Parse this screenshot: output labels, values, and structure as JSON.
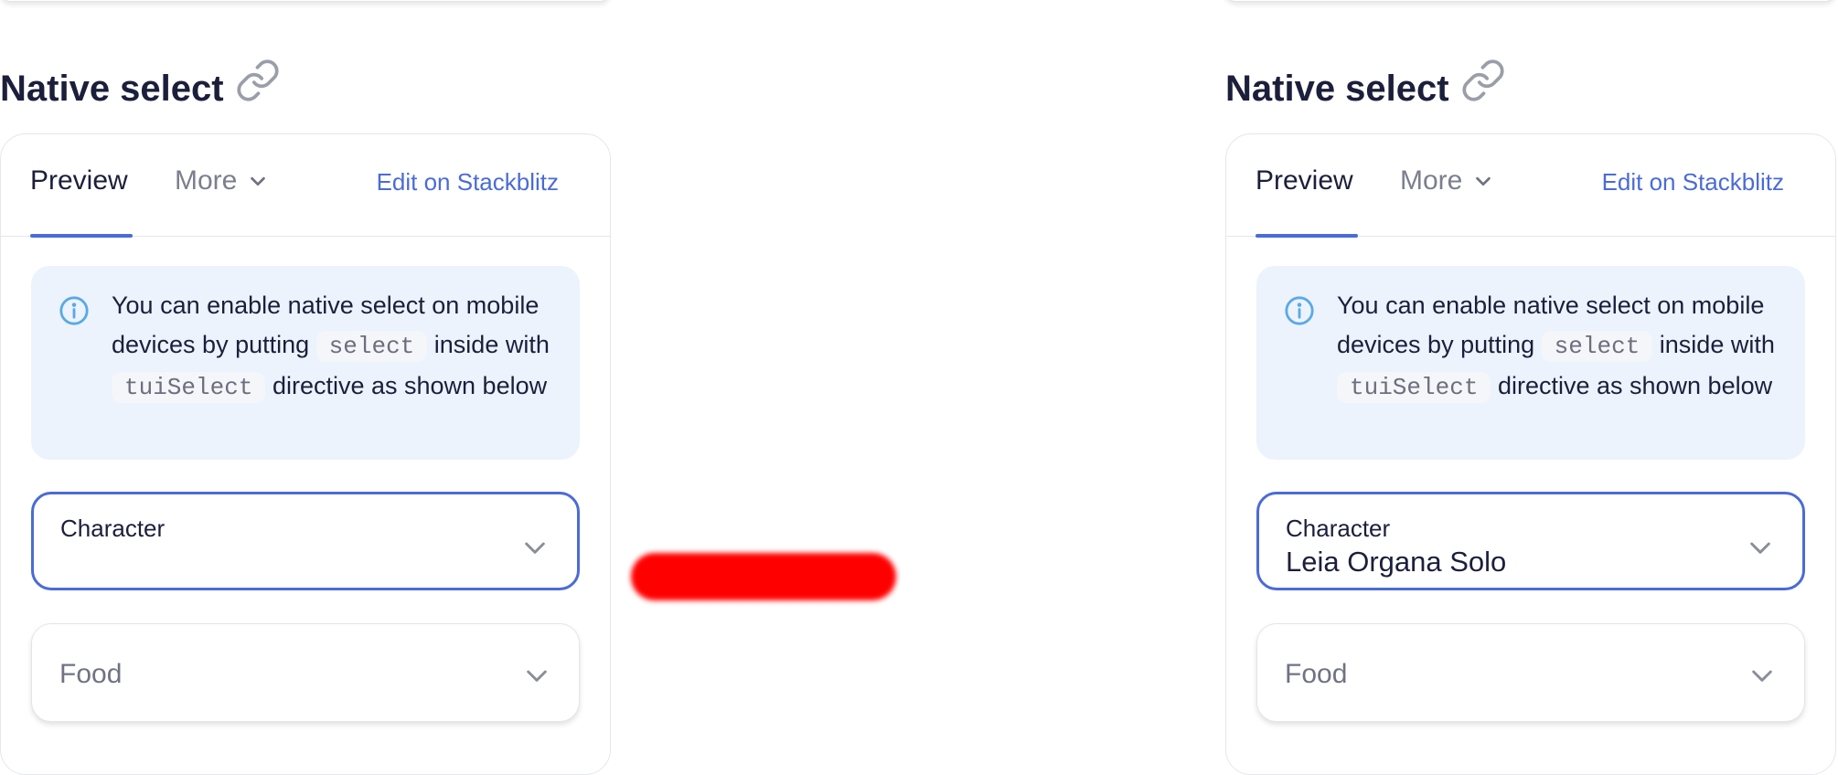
{
  "panels": [
    {
      "heading": "Native select",
      "tabs": {
        "preview": "Preview",
        "more": "More",
        "edit": "Edit on Stackblitz"
      },
      "notice": {
        "prefix": "You can enable native select on mobile devices by putting",
        "code1": "select",
        "middle": "inside with",
        "code2": "tuiSelect",
        "suffix": "directive as shown below"
      },
      "character_select": {
        "label": "Character",
        "value": ""
      },
      "food_select": {
        "placeholder": "Food"
      }
    },
    {
      "heading": "Native select",
      "tabs": {
        "preview": "Preview",
        "more": "More",
        "edit": "Edit on Stackblitz"
      },
      "notice": {
        "prefix": "You can enable native select on mobile devices by putting",
        "code1": "select",
        "middle": "inside with",
        "code2": "tuiSelect",
        "suffix": "directive as shown below"
      },
      "character_select": {
        "label": "Character",
        "value": "Leia Organa Solo"
      },
      "food_select": {
        "placeholder": "Food"
      }
    }
  ],
  "icons": {
    "heading": "link-icon",
    "tab_more": "chevron-down-icon",
    "notice": "info-icon",
    "select": "chevron-down-icon"
  },
  "colors": {
    "accent": "#4b6bd6",
    "notice_bg": "#ecf3fd",
    "text": "#1b1f3b",
    "muted": "#7b7f8d",
    "annotation_scribble": "#ff0000"
  }
}
